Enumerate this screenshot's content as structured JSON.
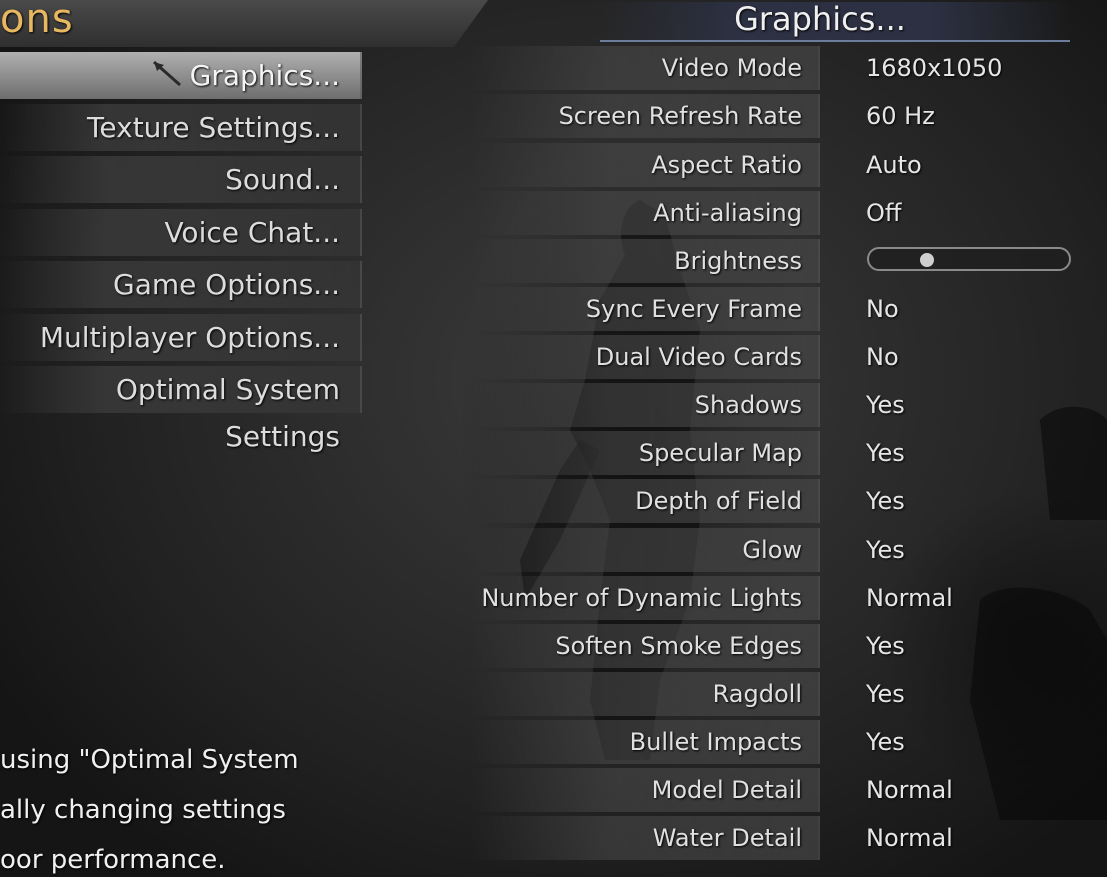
{
  "title": "ons",
  "menu": {
    "items": [
      {
        "label": "Graphics...",
        "selected": true
      },
      {
        "label": "Texture Settings..."
      },
      {
        "label": "Sound..."
      },
      {
        "label": "Voice Chat..."
      },
      {
        "label": "Game Options..."
      },
      {
        "label": "Multiplayer Options..."
      },
      {
        "label": "Optimal System Settings"
      }
    ]
  },
  "description": {
    "lines": [
      "using \"Optimal System",
      "ally changing settings",
      "oor performance."
    ]
  },
  "panel": {
    "title": "Graphics...",
    "settings": [
      {
        "label": "Video Mode",
        "value": "1680x1050"
      },
      {
        "label": "Screen Refresh Rate",
        "value": "60 Hz"
      },
      {
        "label": "Aspect Ratio",
        "value": "Auto"
      },
      {
        "label": "Anti-aliasing",
        "value": "Off"
      },
      {
        "label": "Brightness",
        "value": "",
        "slider": 0.27
      },
      {
        "label": "Sync Every Frame",
        "value": "No"
      },
      {
        "label": "Dual Video Cards",
        "value": "No"
      },
      {
        "label": "Shadows",
        "value": "Yes"
      },
      {
        "label": "Specular Map",
        "value": "Yes"
      },
      {
        "label": "Depth of Field",
        "value": "Yes"
      },
      {
        "label": "Glow",
        "value": "Yes"
      },
      {
        "label": "Number of Dynamic Lights",
        "value": "Normal"
      },
      {
        "label": "Soften Smoke Edges",
        "value": "Yes"
      },
      {
        "label": "Ragdoll",
        "value": "Yes"
      },
      {
        "label": "Bullet Impacts",
        "value": "Yes"
      },
      {
        "label": "Model Detail",
        "value": "Normal"
      },
      {
        "label": "Water Detail",
        "value": "Normal"
      }
    ]
  },
  "colors": {
    "title_accent": "#e8b860",
    "header_underline": "#6b7d9a"
  }
}
